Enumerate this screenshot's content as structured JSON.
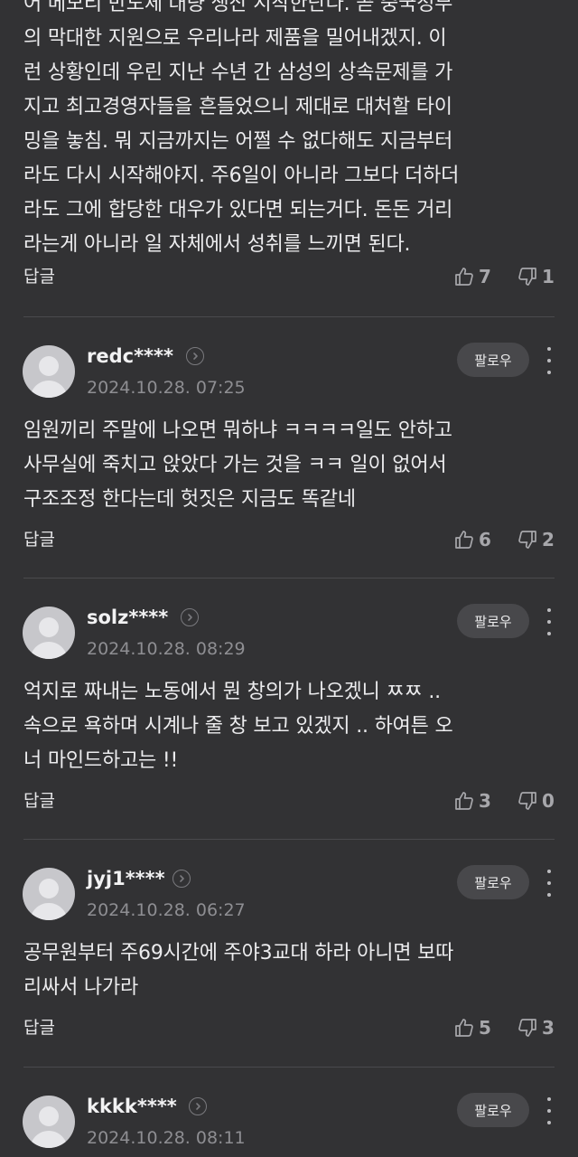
{
  "top_comment": {
    "text": "어 메모리 반도체 대량 생산 시작한단다. 곧 중국정부\n의 막대한 지원으로 우리나라 제품을 밀어내겠지. 이\n런 상황인데 우린 지난 수년 간 삼성의 상속문제를 가\n지고 최고경영자들을 흔들었으니 제대로 대처할 타이\n밍을 놓침. 뭐 지금까지는 어쩔 수 없다해도 지금부터\n라도 다시 시작해야지. 주6일이 아니라 그보다 더하더\n라도 그에 합당한 대우가 있다면 되는거다. 돈돈 거리\n라는게 아니라 일 자체에서 성취를 느끼면 된다.",
    "reply_label": "답글",
    "likes": "7",
    "dislikes": "1"
  },
  "comments": [
    {
      "username": "redc****",
      "date": "2024.10.28. 07:25",
      "follow_label": "팔로우",
      "text": "임원끼리 주말에 나오면 뭐하냐 ㅋㅋㅋㅋ일도 안하고\n사무실에 죽치고 앉았다 가는 것을 ㅋㅋ 일이 없어서\n구조조정 한다는데 헛짓은 지금도 똑같네",
      "reply_label": "답글",
      "likes": "6",
      "dislikes": "2"
    },
    {
      "username": "solz****",
      "date": "2024.10.28. 08:29",
      "follow_label": "팔로우",
      "text": "억지로 짜내는 노동에서 뭔 창의가 나오겠니 ㅉㅉ ..\n속으로 욕하며 시계나 줄 창 보고 있겠지 .. 하여튼 오\n너 마인드하고는 !!",
      "reply_label": "답글",
      "likes": "3",
      "dislikes": "0"
    },
    {
      "username": "jyj1****",
      "date": "2024.10.28. 06:27",
      "follow_label": "팔로우",
      "text": "공무원부터 주69시간에 주야3교대 하라 아니면 보따\n리싸서 나가라",
      "reply_label": "답글",
      "likes": "5",
      "dislikes": "3"
    },
    {
      "username": "kkkk****",
      "date": "2024.10.28. 08:11",
      "follow_label": "팔로우",
      "text": "",
      "reply_label": "",
      "likes": "",
      "dislikes": ""
    }
  ],
  "icons": {
    "like": "thumbs-up-icon",
    "dislike": "thumbs-down-icon",
    "profile_link": "chevron-right-circle-icon",
    "more": "more-vertical-icon",
    "avatar": "default-avatar-icon"
  },
  "colors": {
    "background": "#323234",
    "text": "#ececee",
    "secondary_text": "#8e8e92",
    "follow_button_bg": "#48484b",
    "divider": "#4a4a4d"
  }
}
